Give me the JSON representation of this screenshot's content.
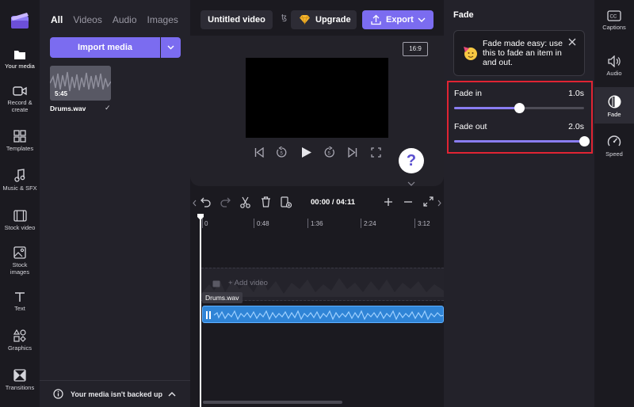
{
  "colors": {
    "accent": "#7b6cf0",
    "highlight": "#e02433",
    "audio_clip": "#2f84d6"
  },
  "left_nav": {
    "items": [
      {
        "label": "Your media",
        "icon": "folder-icon"
      },
      {
        "label": "Record &",
        "label2": "create",
        "icon": "camera-icon"
      },
      {
        "label": "Templates",
        "icon": "templates-icon"
      },
      {
        "label": "Music & SFX",
        "icon": "music-icon"
      },
      {
        "label": "Stock video",
        "icon": "film-icon"
      },
      {
        "label": "Stock",
        "label2": "images",
        "icon": "image-icon"
      },
      {
        "label": "Text",
        "icon": "text-icon"
      },
      {
        "label": "Graphics",
        "icon": "shapes-icon"
      },
      {
        "label": "Transitions",
        "icon": "transitions-icon"
      }
    ]
  },
  "media_panel": {
    "tabs": [
      "All",
      "Videos",
      "Audio",
      "Images"
    ],
    "import_label": "Import media",
    "item": {
      "duration": "5:45",
      "name": "Drums.wav"
    },
    "backup_text": "Your media isn't backed up"
  },
  "topbar": {
    "title": "Untitled video",
    "upgrade_label": "Upgrade",
    "export_label": "Export"
  },
  "preview": {
    "aspect": "16:9",
    "help": "?"
  },
  "timeline": {
    "time": "00:00 / 04:11",
    "ruler": [
      "0",
      "0:48",
      "1:36",
      "2:24",
      "3:12"
    ],
    "add_video": "+ Add video",
    "clip_name": "Drums.wav"
  },
  "props": {
    "title": "Fade",
    "tip": "Fade made easy: use this to fade an item in and out.",
    "fade_in": {
      "label": "Fade in",
      "value": "1.0s",
      "fraction": 0.5
    },
    "fade_out": {
      "label": "Fade out",
      "value": "2.0s",
      "fraction": 1.0
    }
  },
  "right_rail": {
    "items": [
      {
        "label": "Captions",
        "icon": "captions-icon"
      },
      {
        "label": "Audio",
        "icon": "speaker-icon"
      },
      {
        "label": "Fade",
        "icon": "fade-icon"
      },
      {
        "label": "Speed",
        "icon": "speedometer-icon"
      }
    ]
  }
}
